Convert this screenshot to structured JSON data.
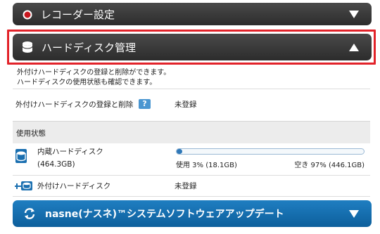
{
  "recorder_settings": {
    "title": "レコーダー設定"
  },
  "hdd_management": {
    "title": "ハードディスク管理",
    "description_line1": "外付けハードディスクの登録と削除ができます。",
    "description_line2": "ハードディスクの使用状態も確認できます。",
    "external_register": {
      "label": "外付けハードディスクの登録と削除",
      "help_label": "?",
      "value": "未登録"
    },
    "usage_section": {
      "title": "使用状態"
    },
    "internal": {
      "name": "内蔵ハードディスク",
      "capacity": "(464.3GB)",
      "used_text": "使用 3% (18.1GB)",
      "free_text": "空き 97% (446.1GB)",
      "used_fraction": 0.03
    },
    "external": {
      "name": "外付けハードディスク",
      "value": "未登録"
    }
  },
  "software_update": {
    "title": "nasne(ナスネ)™システムソフトウェアアップデート"
  },
  "colors": {
    "highlight": "#e2232a",
    "dark_bar": "#3a3a3a",
    "blue_bar": "#1272b3",
    "progress": "#2f78b8"
  }
}
